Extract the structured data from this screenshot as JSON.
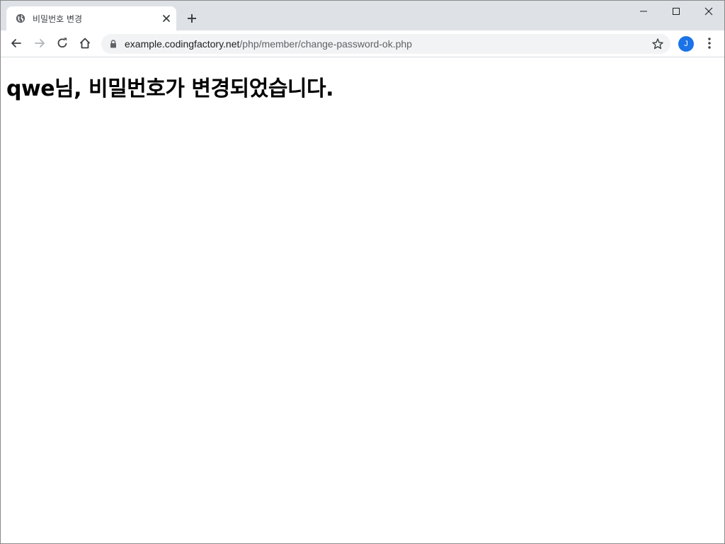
{
  "browser": {
    "tab": {
      "title": "비밀번호 변경",
      "favicon": "globe-icon"
    },
    "new_tab_icon": "plus-icon",
    "window_controls": [
      "minimize-icon",
      "maximize-icon",
      "close-icon"
    ],
    "address_bar": {
      "lock_icon": "lock-icon",
      "url_host": "example.codingfactory.net",
      "url_path": "/php/member/change-password-ok.php",
      "bookmark_icon": "star-icon"
    },
    "profile_initial": "J",
    "profile_color": "#1a73e8"
  },
  "page": {
    "heading": "qwe님, 비밀번호가 변경되었습니다."
  }
}
